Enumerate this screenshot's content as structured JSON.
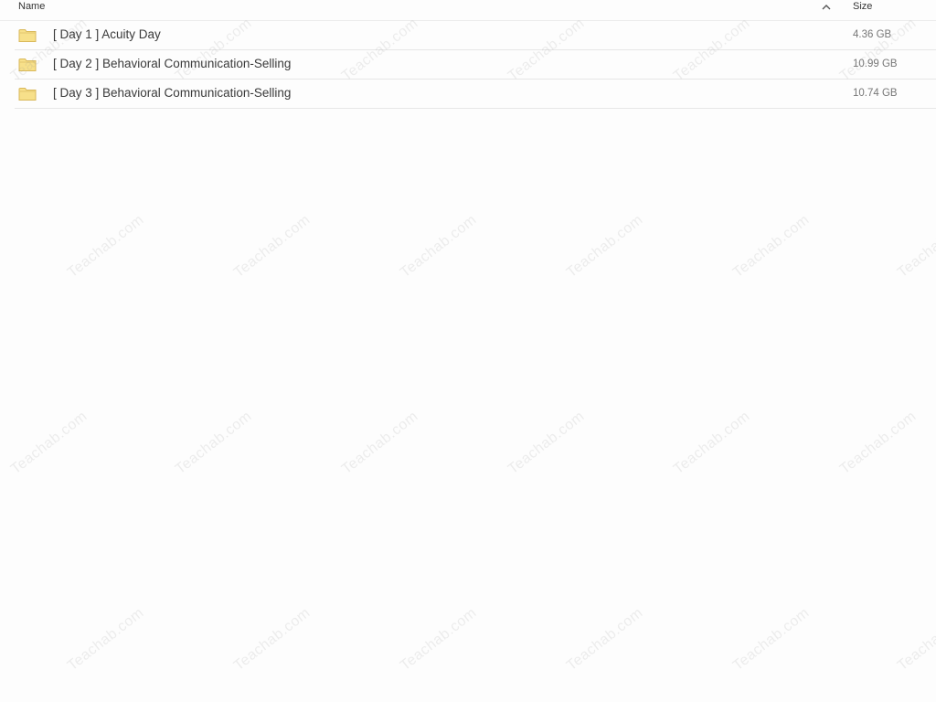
{
  "header": {
    "name_label": "Name",
    "size_label": "Size",
    "sort_icon": "chevron-up-icon"
  },
  "files": [
    {
      "name": "[ Day 1 ] Acuity Day",
      "size": "4.36 GB",
      "icon": "folder-icon"
    },
    {
      "name": "[ Day 2 ] Behavioral Communication-Selling",
      "size": "10.99 GB",
      "icon": "folder-icon"
    },
    {
      "name": "[ Day 3 ] Behavioral Communication-Selling",
      "size": "10.74 GB",
      "icon": "folder-icon"
    }
  ],
  "watermark": {
    "text": "Teachab.com"
  },
  "colors": {
    "folder_fill": "#f7e08a",
    "folder_stroke": "#d9b85a",
    "background": "#fdfdfd"
  }
}
